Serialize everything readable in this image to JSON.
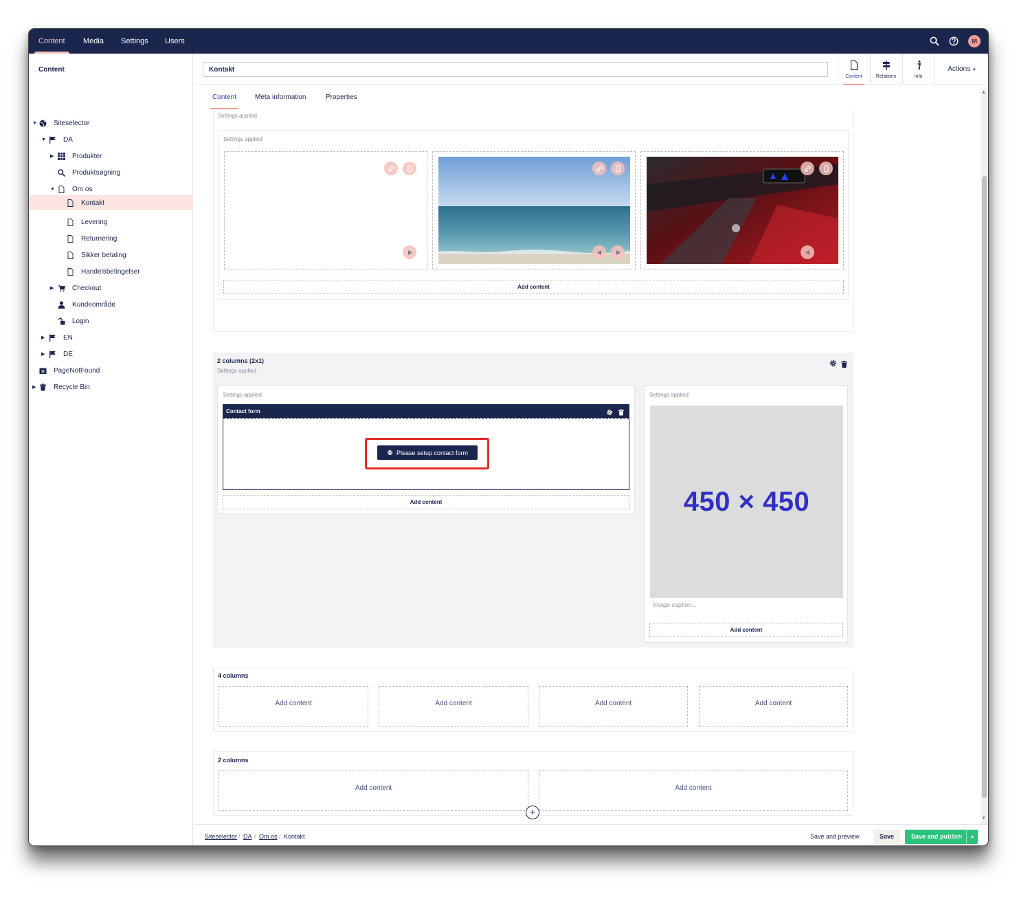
{
  "topbar": {
    "nav": [
      "Content",
      "Media",
      "Settings",
      "Users"
    ],
    "user_initial": "M"
  },
  "sidebar": {
    "title": "Content",
    "items": [
      {
        "label": "Siteselector",
        "icon": "globe-icon"
      },
      {
        "label": "DA",
        "icon": "flag-icon"
      },
      {
        "label": "Produkter",
        "icon": "grid-icon"
      },
      {
        "label": "Produktsøgning",
        "icon": "search-icon"
      },
      {
        "label": "Om os",
        "icon": "document-icon"
      },
      {
        "label": "Kontakt",
        "icon": "document-icon"
      },
      {
        "label": "Levering",
        "icon": "document-icon"
      },
      {
        "label": "Returnering",
        "icon": "document-icon"
      },
      {
        "label": "Sikker betaling",
        "icon": "document-icon"
      },
      {
        "label": "Handelsbetingelser",
        "icon": "document-icon"
      },
      {
        "label": "Checkout",
        "icon": "cart-icon"
      },
      {
        "label": "Kundeområde",
        "icon": "user-icon"
      },
      {
        "label": "Login",
        "icon": "unlock-icon"
      },
      {
        "label": "EN",
        "icon": "flag-icon"
      },
      {
        "label": "DE",
        "icon": "flag-icon"
      },
      {
        "label": "PageNotFound",
        "icon": "missing-page-icon"
      },
      {
        "label": "Recycle Bin",
        "icon": "trash-icon"
      }
    ]
  },
  "header": {
    "name_value": "Kontakt",
    "apps": [
      "Content",
      "Relations",
      "Info"
    ],
    "actions_label": "Actions"
  },
  "tabs": [
    "Content",
    "Meta information",
    "Properties"
  ],
  "grid": {
    "settings_applied": "Settings applied",
    "add_content": "Add content",
    "section2_title": "2 columns (2x1)",
    "contact_form_title": "Contact form",
    "setup_button": "Please setup contact form",
    "placeholder_text": "450 × 450",
    "image_caption_placeholder": "Image caption...",
    "section3_title": "4 columns",
    "section4_title": "2 columns"
  },
  "footer": {
    "breadcrumb": [
      "Siteselector",
      "DA",
      "Om os",
      "Kontakt"
    ],
    "save_preview": "Save and preview",
    "save": "Save",
    "save_publish": "Save and publish"
  },
  "colors": {
    "primary": "#1b264f",
    "accent": "#f79c93",
    "publish": "#2bc37c",
    "highlight": "#e52b2b",
    "placeholder_text": "#2f32c4"
  }
}
